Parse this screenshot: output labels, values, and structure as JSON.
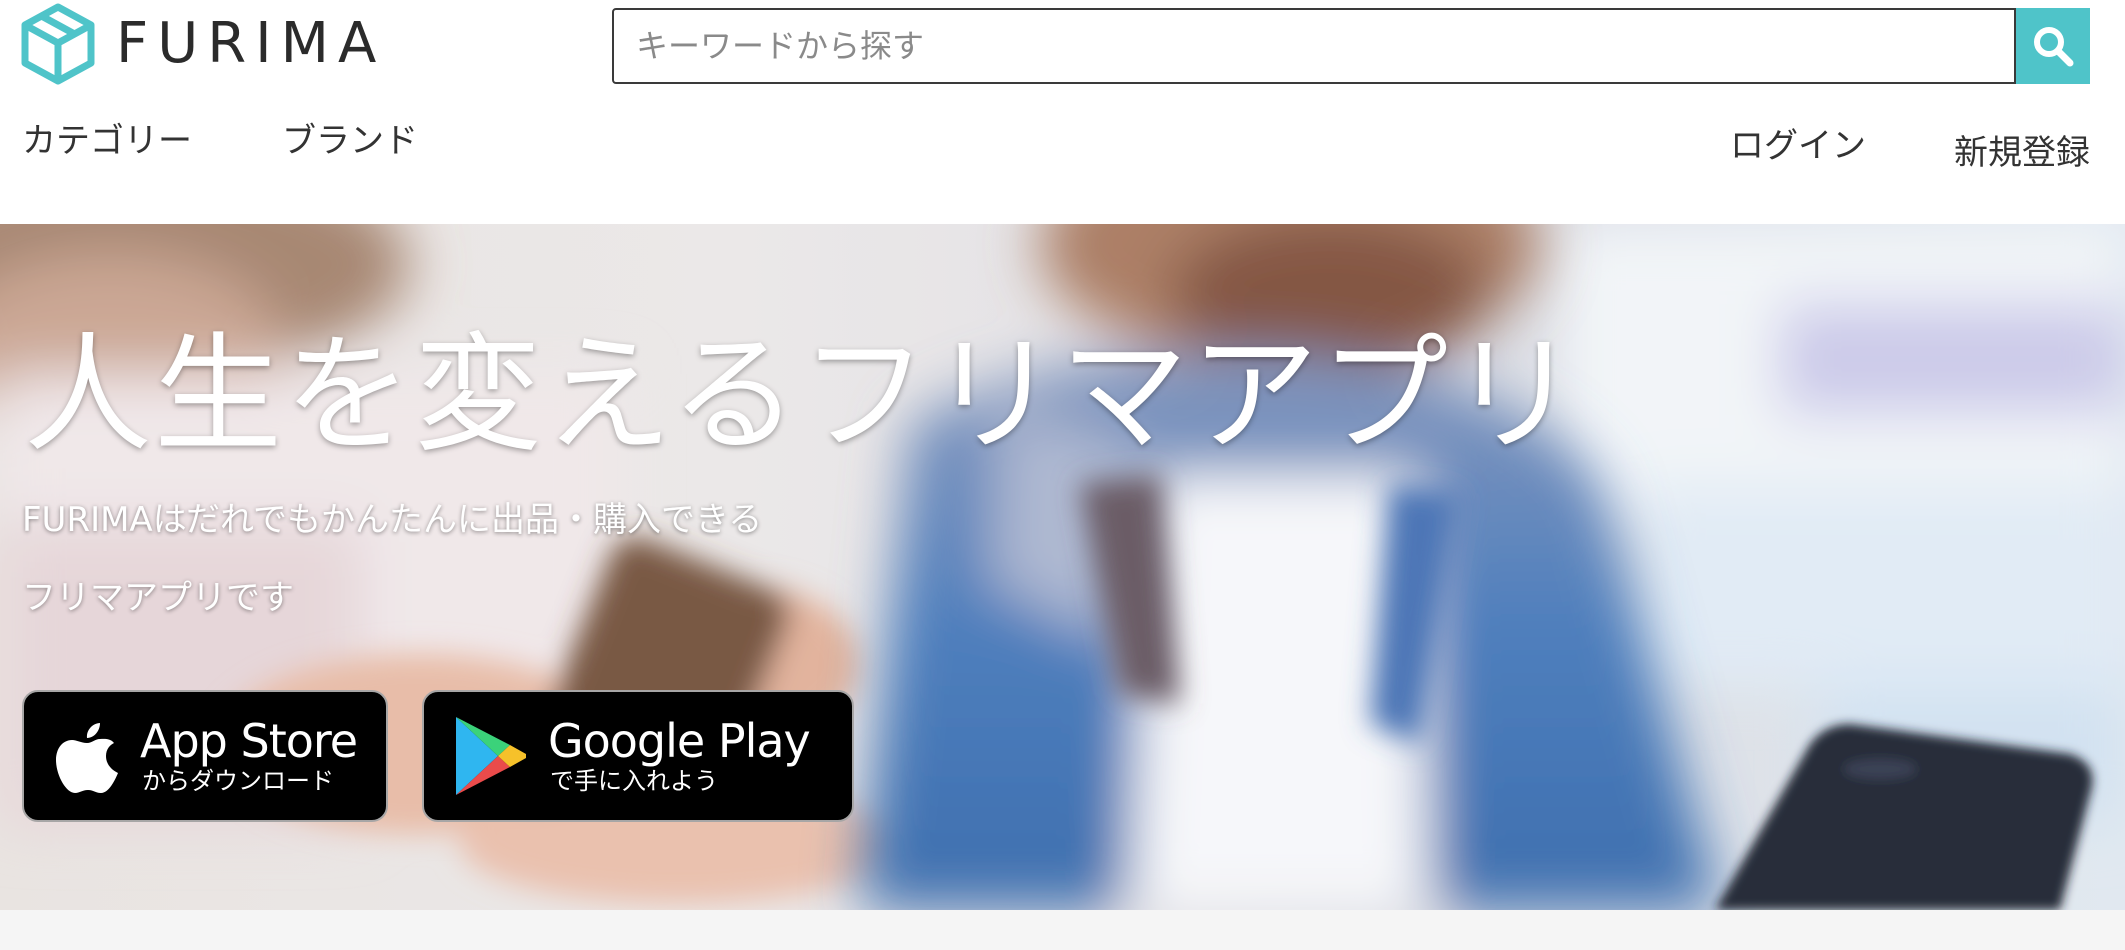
{
  "header": {
    "logo_text": "FURIMA",
    "search": {
      "placeholder": "キーワードから探す",
      "value": ""
    },
    "nav_left": [
      {
        "label": "カテゴリー"
      },
      {
        "label": "ブランド"
      }
    ],
    "nav_right": [
      {
        "label": "ログイン"
      },
      {
        "label": "新規登録"
      }
    ]
  },
  "hero": {
    "title": "人生を変えるフリマアプリ",
    "subtitle_line1": "FURIMAはだれでもかんたんに出品・購入できる",
    "subtitle_line2": "フリマアプリです",
    "app_store": {
      "title": "App Store",
      "caption": "からダウンロード",
      "icon": "apple-icon"
    },
    "google_play": {
      "title": "Google Play",
      "caption": "で手に入れよう",
      "icon": "google-play-icon"
    }
  },
  "colors": {
    "accent": "#4fc4c9",
    "text": "#333333",
    "badge_bg": "#000000",
    "hero_denim": "#3a6fb3"
  },
  "icons": {
    "logo": "box-cube-icon",
    "search": "search-icon"
  }
}
